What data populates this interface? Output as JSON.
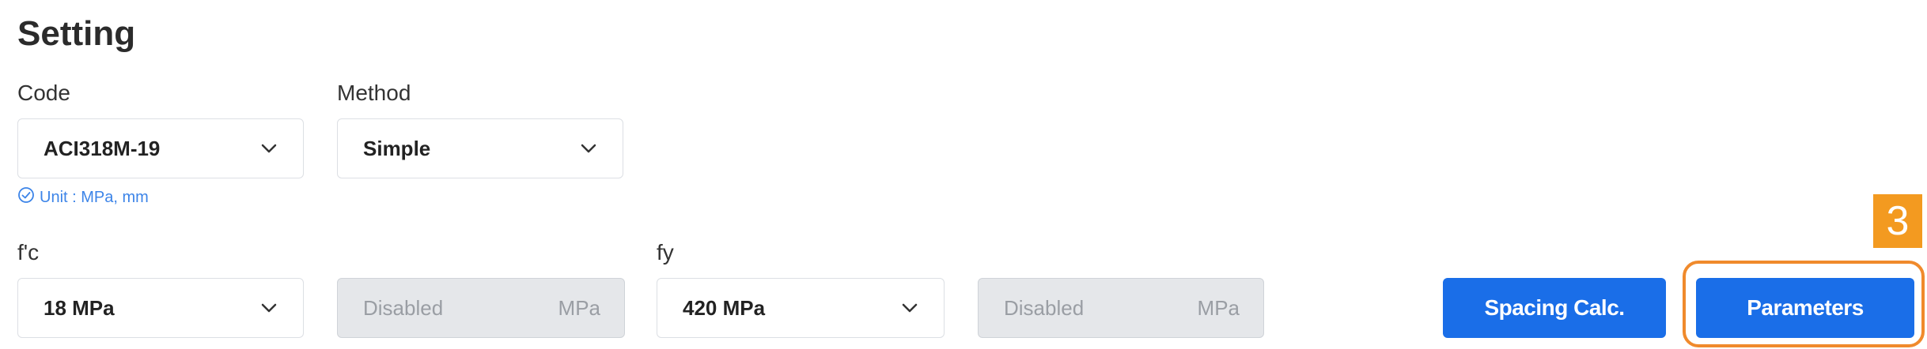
{
  "page": {
    "title": "Setting"
  },
  "code": {
    "label": "Code",
    "value": "ACI318M-19",
    "unit_note": "Unit : MPa, mm"
  },
  "method": {
    "label": "Method",
    "value": "Simple"
  },
  "fc": {
    "label": "f'c",
    "value": "18 MPa",
    "disabled_text": "Disabled",
    "disabled_unit": "MPa"
  },
  "fy": {
    "label": "fy",
    "value": "420 MPa",
    "disabled_text": "Disabled",
    "disabled_unit": "MPa"
  },
  "buttons": {
    "spacing": "Spacing Calc.",
    "parameters": "Parameters"
  },
  "annotation": {
    "marker": "3",
    "color": "#f08a2c"
  },
  "colors": {
    "accent": "#1a6ee8",
    "note": "#3c84e8"
  },
  "icons": [
    "chevron-down-icon",
    "check-circle-icon"
  ]
}
